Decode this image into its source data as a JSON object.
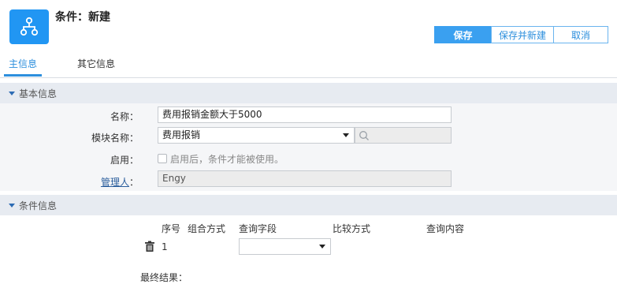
{
  "header": {
    "title": "条件：新建",
    "app_icon": "workflow-hierarchy-icon"
  },
  "toolbar": {
    "save_label": "保存",
    "save_new_label": "保存并新建",
    "cancel_label": "取消"
  },
  "tabs": [
    {
      "label": "主信息",
      "active": true
    },
    {
      "label": "其它信息",
      "active": false
    }
  ],
  "sections": {
    "basic": "基本信息",
    "condition": "条件信息"
  },
  "form": {
    "name_label": "名称：",
    "name_value": "费用报销金额大于5000",
    "module_label": "模块名称：",
    "module_value": "费用报销",
    "enable_label": "启用：",
    "enable_hint": "启用后，条件才能被使用。",
    "enable_checked": false,
    "manager_label": "管理人",
    "manager_colon": "：",
    "manager_value": "Engy"
  },
  "condition_table": {
    "columns": [
      "序号",
      "组合方式",
      "查询字段",
      "比较方式",
      "查询内容"
    ],
    "rows": [
      {
        "no": "1",
        "field": ""
      }
    ]
  },
  "final_result_label": "最终结果：",
  "colors": {
    "accent": "#2196f3",
    "primary_button": "#3aa0f0",
    "section_bg": "#e7ebf1",
    "link": "#2a5d9c"
  }
}
